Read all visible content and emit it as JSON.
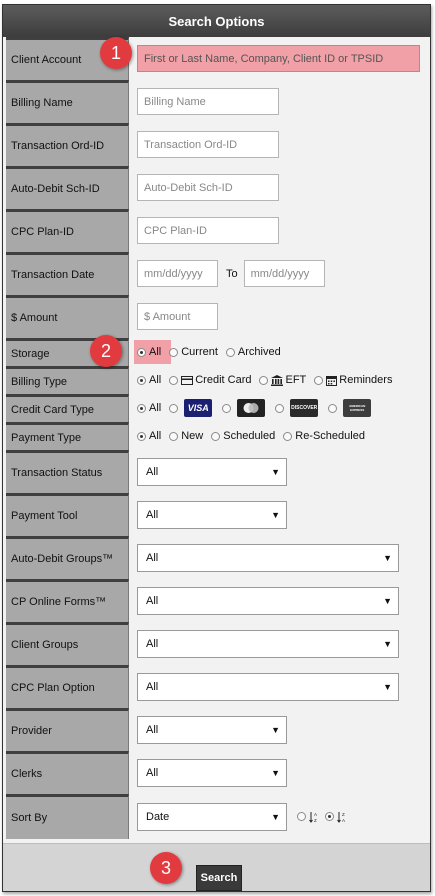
{
  "header": {
    "title": "Search Options"
  },
  "badges": {
    "b1": "1",
    "b2": "2",
    "b3": "3"
  },
  "client_account": {
    "label": "Client Account",
    "placeholder": "First or Last Name, Company, Client ID or TPSID"
  },
  "billing_name": {
    "label": "Billing Name",
    "placeholder": "Billing Name"
  },
  "transaction_ord": {
    "label": "Transaction Ord-ID",
    "placeholder": "Transaction Ord-ID"
  },
  "auto_debit_sch": {
    "label": "Auto-Debit Sch-ID",
    "placeholder": "Auto-Debit Sch-ID"
  },
  "cpc_plan_id": {
    "label": "CPC Plan-ID",
    "placeholder": "CPC Plan-ID"
  },
  "transaction_date": {
    "label": "Transaction Date",
    "from_placeholder": "mm/dd/yyyy",
    "to_label": "To",
    "to_placeholder": "mm/dd/yyyy"
  },
  "amount": {
    "label": "$ Amount",
    "placeholder": "$ Amount"
  },
  "storage": {
    "label": "Storage",
    "options": [
      "All",
      "Current",
      "Archived"
    ],
    "selected": "All"
  },
  "billing_type": {
    "label": "Billing Type",
    "options": [
      "All",
      "Credit Card",
      "EFT",
      "Reminders"
    ],
    "selected": "All"
  },
  "credit_card_type": {
    "label": "Credit Card Type",
    "all_label": "All",
    "cards": [
      "VISA",
      "MasterCard",
      "DISCOVER",
      "AMERICAN EXPRESS"
    ],
    "selected": "All"
  },
  "payment_type": {
    "label": "Payment Type",
    "options": [
      "All",
      "New",
      "Scheduled",
      "Re-Scheduled"
    ],
    "selected": "All"
  },
  "transaction_status": {
    "label": "Transaction Status",
    "value": "All"
  },
  "payment_tool": {
    "label": "Payment Tool",
    "value": "All"
  },
  "auto_debit_groups": {
    "label": "Auto-Debit Groups™",
    "value": "All"
  },
  "cp_online_forms": {
    "label": "CP Online Forms™",
    "value": "All"
  },
  "client_groups": {
    "label": "Client Groups",
    "value": "All"
  },
  "cpc_plan_option": {
    "label": "CPC Plan Option",
    "value": "All"
  },
  "provider": {
    "label": "Provider",
    "value": "All"
  },
  "clerks": {
    "label": "Clerks",
    "value": "All"
  },
  "sort_by": {
    "label": "Sort By",
    "value": "Date",
    "order_selected": "descending"
  },
  "footer": {
    "search_label": "Search"
  },
  "colors": {
    "header_bg": "#474747",
    "label_bg": "#a8a8a8",
    "badge": "#e23b3f",
    "highlight": "#f0a0a6"
  }
}
